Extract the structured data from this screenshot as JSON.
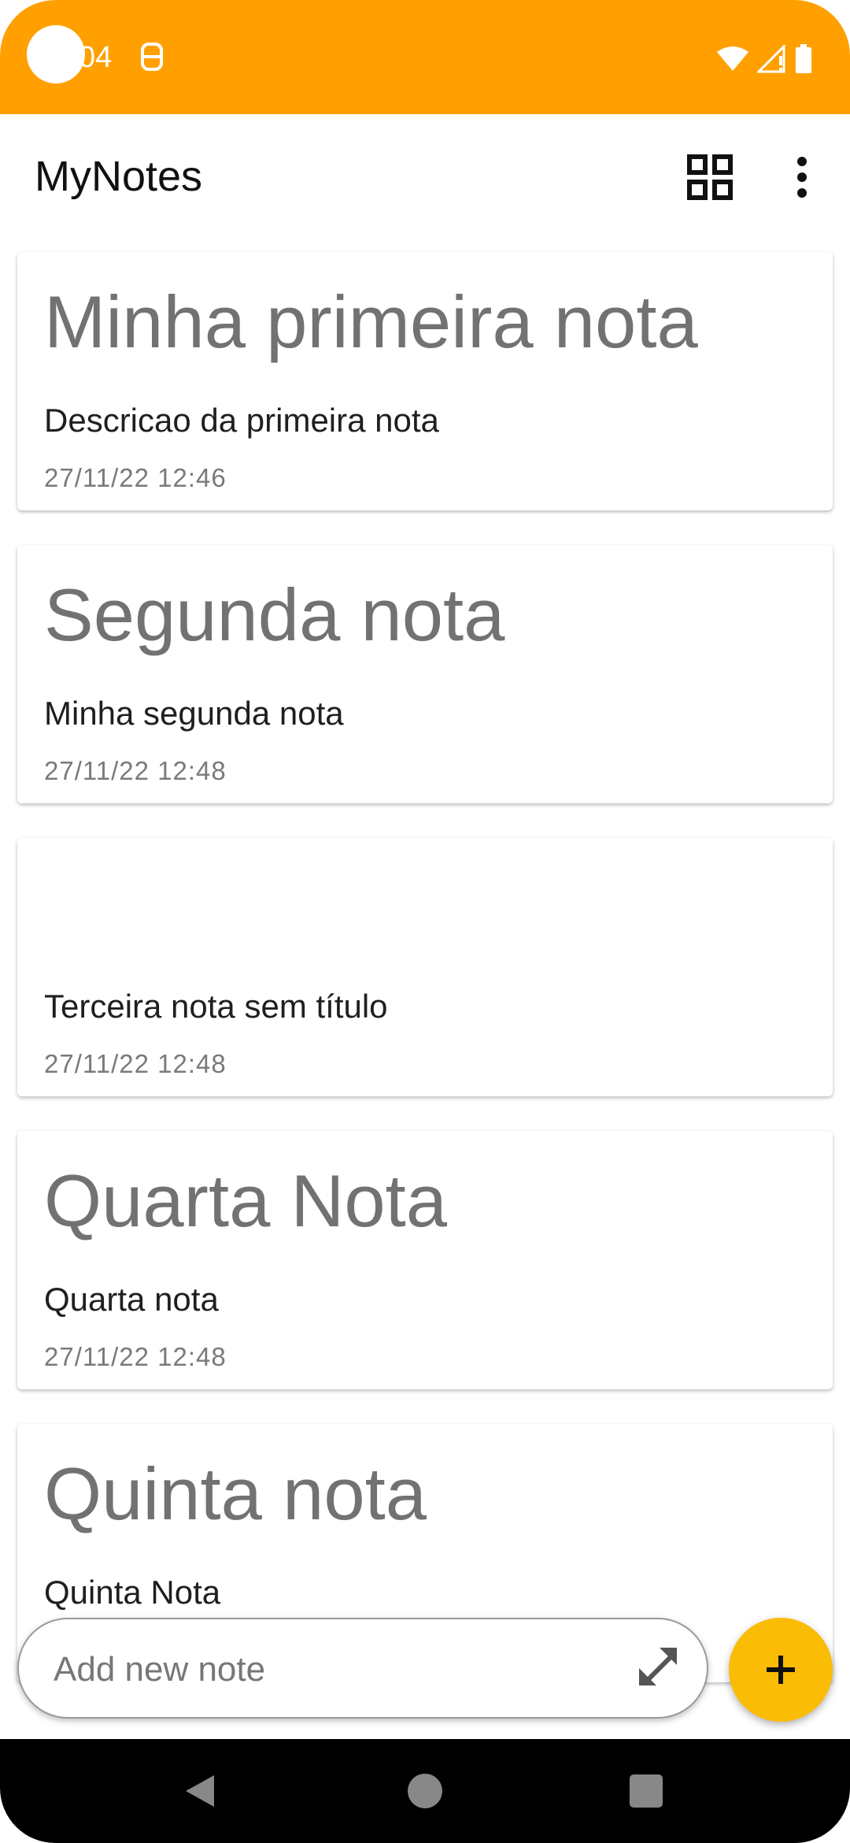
{
  "status_bar": {
    "time": "04",
    "notification_icon": "notification-s-icon",
    "right_icons": [
      "wifi-icon",
      "signal-icon",
      "battery-icon"
    ],
    "background_color": "#FFA000"
  },
  "app_bar": {
    "title": "MyNotes",
    "grid_icon": "grid-view-icon",
    "more_icon": "more-vert-icon"
  },
  "notes": [
    {
      "title": "Minha primeira nota",
      "description": "Descricao da primeira nota",
      "date": "27/11/22 12:46"
    },
    {
      "title": "Segunda nota",
      "description": "Minha segunda nota",
      "date": "27/11/22 12:48"
    },
    {
      "title": "",
      "description": "Terceira nota sem título",
      "date": "27/11/22 12:48"
    },
    {
      "title": "Quarta Nota",
      "description": "Quarta nota",
      "date": "27/11/22 12:48"
    },
    {
      "title": "Quinta nota",
      "description": "Quinta Nota",
      "date": ""
    }
  ],
  "add_note": {
    "placeholder": "Add new note",
    "expand_icon": "expand-icon"
  },
  "fab": {
    "icon": "plus-icon",
    "color": "#FBBC05"
  },
  "nav_bar": {
    "back_icon": "back-icon",
    "home_icon": "home-icon",
    "recents_icon": "recents-icon"
  }
}
